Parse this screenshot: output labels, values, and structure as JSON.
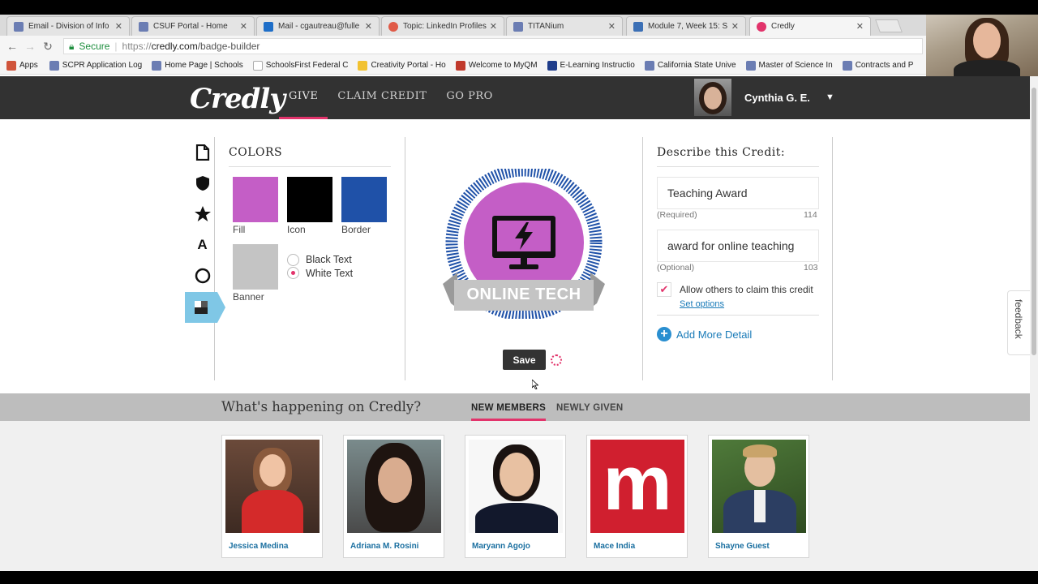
{
  "browser": {
    "tabs": [
      {
        "label": "Email - Division of Info",
        "color": "#6b7db3"
      },
      {
        "label": "CSUF Portal - Home",
        "color": "#6b7db3"
      },
      {
        "label": "Mail - cgautreau@fulle",
        "color": "#1e6ec8"
      },
      {
        "label": "Topic: LinkedIn Profiles",
        "color": "#e05a47"
      },
      {
        "label": "TITANium",
        "color": "#6b7db3"
      },
      {
        "label": "Module 7, Week 15: S",
        "color": "#3b6fb5"
      },
      {
        "label": "Credly",
        "color": "#e2336b"
      }
    ],
    "secure_label": "Secure",
    "url_prefix": "https://",
    "url_domain": "credly.com",
    "url_path": "/badge-builder",
    "bookmarks": [
      {
        "label": "Apps",
        "color": "#d0543b"
      },
      {
        "label": "SCPR Application Log",
        "color": "#6b7db3"
      },
      {
        "label": "Home Page | Schools",
        "color": "#6b7db3"
      },
      {
        "label": "SchoolsFirst Federal C",
        "color": "#aaaaaa"
      },
      {
        "label": "Creativity Portal - Ho",
        "color": "#f2c230"
      },
      {
        "label": "Welcome to MyQM",
        "color": "#c0392b"
      },
      {
        "label": "E-Learning Instructio",
        "color": "#1e3c8a"
      },
      {
        "label": "California State Unive",
        "color": "#6b7db3"
      },
      {
        "label": "Master of Science In",
        "color": "#6b7db3"
      },
      {
        "label": "Contracts and P",
        "color": "#6b7db3"
      }
    ]
  },
  "header": {
    "logo": "Credly",
    "nav": [
      "GIVE",
      "CLAIM CREDIT",
      "GO PRO"
    ],
    "user_name": "Cynthia G. E.",
    "caret": "▼"
  },
  "builder": {
    "colors_title": "COLORS",
    "swatches": [
      {
        "label": "Fill",
        "color": "#c45ec6"
      },
      {
        "label": "Icon",
        "color": "#000000"
      },
      {
        "label": "Border",
        "color": "#1f51a8"
      },
      {
        "label": "Banner",
        "color": "#c4c4c4"
      }
    ],
    "text_options": [
      "Black Text",
      "White Text"
    ],
    "selected_text_option": "White Text",
    "badge_banner_text": "ONLINE TECH",
    "save_label": "Save"
  },
  "describe": {
    "title": "Describe this Credit:",
    "name_value": "Teaching Award",
    "name_hint": "(Required)",
    "name_count": "114",
    "desc_value": "award for online teaching",
    "desc_hint": "(Optional)",
    "desc_count": "103",
    "allow_label": "Allow others to claim this credit",
    "allow_checked": true,
    "set_options": "Set options",
    "add_more": "Add More Detail"
  },
  "feedback_label": "feedback",
  "happening": {
    "title": "What's happening on Credly?",
    "tabs": [
      "NEW MEMBERS",
      "NEWLY GIVEN"
    ],
    "members": [
      {
        "name": "Jessica Medina"
      },
      {
        "name": "Adriana M. Rosini"
      },
      {
        "name": "Maryann Agojo"
      },
      {
        "name": "Mace India"
      },
      {
        "name": "Shayne Guest"
      }
    ]
  },
  "accent_color": "#e2336b"
}
